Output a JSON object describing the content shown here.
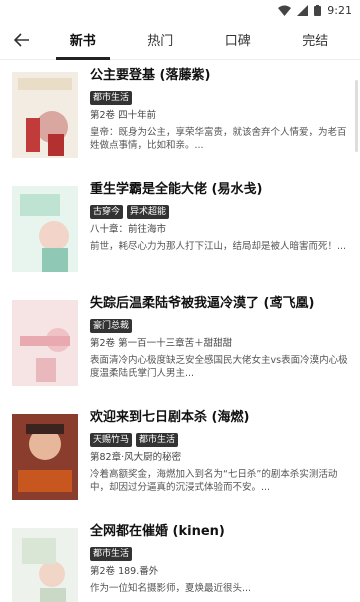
{
  "status": {
    "time": "9:21"
  },
  "tabs": [
    "新书",
    "热门",
    "口碑",
    "完结"
  ],
  "books": [
    {
      "title": "公主要登基 (落藤紫)",
      "tags": [
        "都市生活"
      ],
      "chapter": "第2卷 四十年前",
      "desc": "皇帝：既身为公主，享荣华富贵，就该舍弃个人情爱，为老百姓做点事情，比如和亲。..."
    },
    {
      "title": "重生学霸是全能大佬 (易水戋)",
      "tags": [
        "古穿今",
        "异术超能"
      ],
      "chapter": "八十章：前往海市",
      "desc": "前世，耗尽心力为那人打下江山，结局却是被人暗害而死！..."
    },
    {
      "title": "失踪后温柔陆爷被我逼冷漠了 (鸢飞凰)",
      "tags": [
        "豪门总裁"
      ],
      "chapter": "第2卷 第一百一十三章苦＋甜甜甜",
      "desc": "表面清冷内心极度缺乏安全感国民大佬女主vs表面冷漠内心极度温柔陆氏掌门人男主..."
    },
    {
      "title": "欢迎来到七日剧本杀 (海燃)",
      "tags": [
        "天赐竹马",
        "都市生活"
      ],
      "chapter": "第82章·风大厨的秘密",
      "desc": "冷着高额奖金，海燃加入到名为“七日杀”的剧本杀实测活动中，却因过分逼真的沉浸式体验而不安。..."
    },
    {
      "title": "全网都在催婚 (kinen)",
      "tags": [
        "都市生活"
      ],
      "chapter": "第2卷 189.番外",
      "desc": "作为一位知名摄影师，夏焕最近很头..."
    }
  ]
}
